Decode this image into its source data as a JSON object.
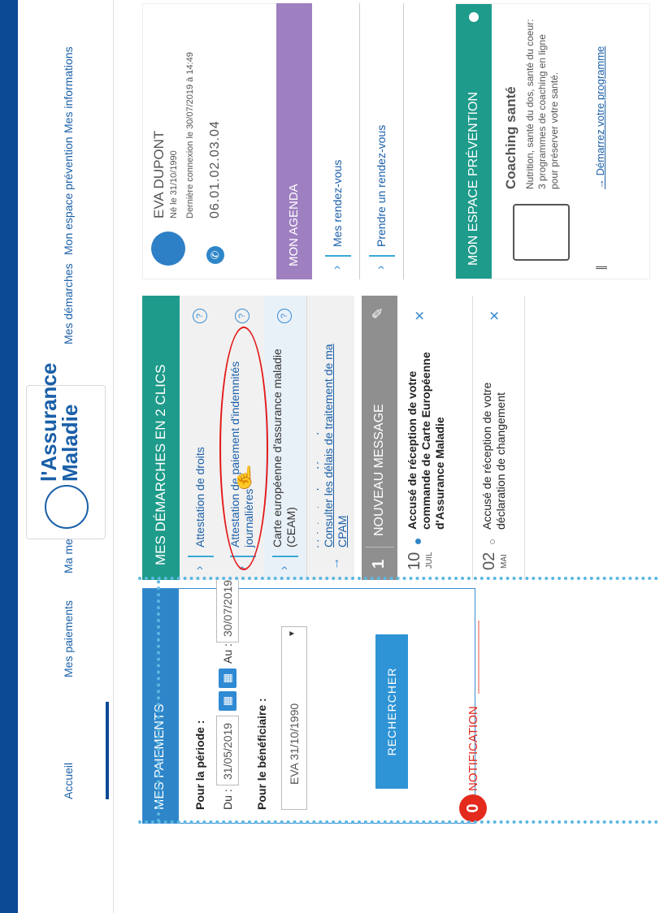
{
  "nav": {
    "items": [
      "Accueil",
      "Mes paiements",
      "Ma messagerie",
      "Mes démarches",
      "Mon espace prévention",
      "Mes informations"
    ],
    "logo": {
      "line1": "l'Assurance",
      "line2": "Maladie"
    }
  },
  "paiements": {
    "title": "MES PAIEMENTS",
    "periode_label": "Pour la période :",
    "du_label": "Du :",
    "du_value": "31/05/2019",
    "au_label": "Au :",
    "au_value": "30/07/2019",
    "beneficiaire_label": "Pour le bénéficiaire :",
    "beneficiaire_value": "EVA    31/10/1990",
    "search_label": "RECHERCHER"
  },
  "notification": {
    "count": "0",
    "label": "NOTIFICATION"
  },
  "demarches": {
    "title": "MES DÉMARCHES EN 2 CLICS",
    "items": [
      "Attestation de droits",
      "Attestation de paiement d'indemnités journalières",
      "Carte européenne d'assurance maladie (CEAM)"
    ],
    "links": [
      "Voir toutes les démarches",
      "Consulter les délais de traitement de ma CPAM"
    ]
  },
  "messages": {
    "count": "1",
    "title": "NOUVEAU MESSAGE",
    "items": [
      {
        "day": "10",
        "month": "JUIL",
        "text": "Accusé de réception de votre commande de Carte Européenne d'Assurance Maladie"
      },
      {
        "day": "02",
        "month": "MAI",
        "text": "Accusé de réception de votre déclaration de changement"
      }
    ]
  },
  "profile": {
    "name": "EVA DUPONT",
    "birth": "Né le 31/10/1990",
    "last_login": "Dernière connexion le 30/07/2019 à 14:49",
    "phone": "06.01.02.03.04"
  },
  "agenda": {
    "title": "MON AGENDA",
    "links": [
      "Mes rendez-vous",
      "Prendre un rendez-vous"
    ]
  },
  "prevention": {
    "title": "MON ESPACE PRÉVENTION",
    "heading": "Coaching santé",
    "body": "Nutrition, santé du dos, santé du coeur: 3 programmes de coaching en ligne pour préserver votre santé.",
    "link": "Démarrez votre programme"
  }
}
